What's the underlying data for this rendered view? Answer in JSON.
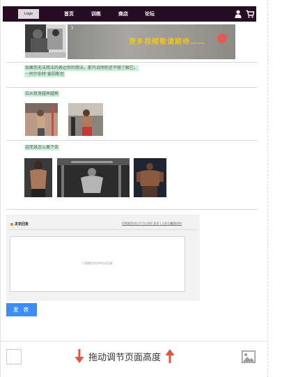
{
  "nav": {
    "logo": "Logo",
    "items": [
      "首页",
      "训练",
      "商店",
      "论坛"
    ],
    "colors": {
      "bg": "#280b25",
      "text": "#ffffff"
    }
  },
  "banner": {
    "ad_text": "更多视频敬请期待……"
  },
  "post": {
    "quote_line1": "如果你无法简洁的表达你的想法，那只说明你还不够了解它。",
    "quote_line2": "－阿尔伯特·爱因斯坦",
    "section1": "白从就身越来越爽",
    "section2": "这而该怎么瘦下去"
  },
  "comment": {
    "title": "发表回复",
    "link1": "您需要登录后才可以回帖 登录 | 立即注册",
    "link2": "提醒规则",
    "placeholder": "只要绑定的方的论坛回复"
  },
  "publish_label": "发 表",
  "bottom": {
    "resize_label": "拖动调节页面高度",
    "arrow_color": "#e8503a"
  },
  "icons": [
    "user-icon",
    "cart-icon",
    "arrow-down-icon",
    "arrow-up-icon",
    "image-icon"
  ]
}
